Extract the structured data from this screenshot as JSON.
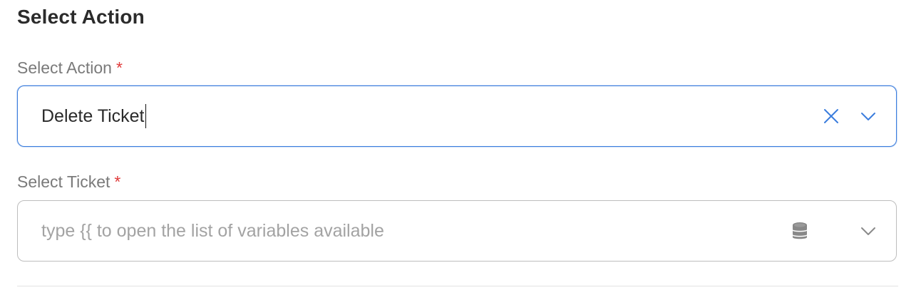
{
  "section": {
    "title": "Select Action"
  },
  "fields": [
    {
      "label": "Select Action",
      "required_mark": "*",
      "value": "Delete Ticket",
      "icons": [
        "clear-icon",
        "chevron-down-icon"
      ],
      "focused": true
    },
    {
      "label": "Select Ticket",
      "required_mark": "*",
      "placeholder": "type {{ to open the list of variables available",
      "icons": [
        "database-icon",
        "chevron-down-icon"
      ],
      "focused": false
    }
  ],
  "colors": {
    "focus_border": "#3b7ddd",
    "required": "#e03a3a",
    "label": "#7a7a7a",
    "placeholder": "#a3a3a3",
    "border": "#bdbdbd"
  }
}
